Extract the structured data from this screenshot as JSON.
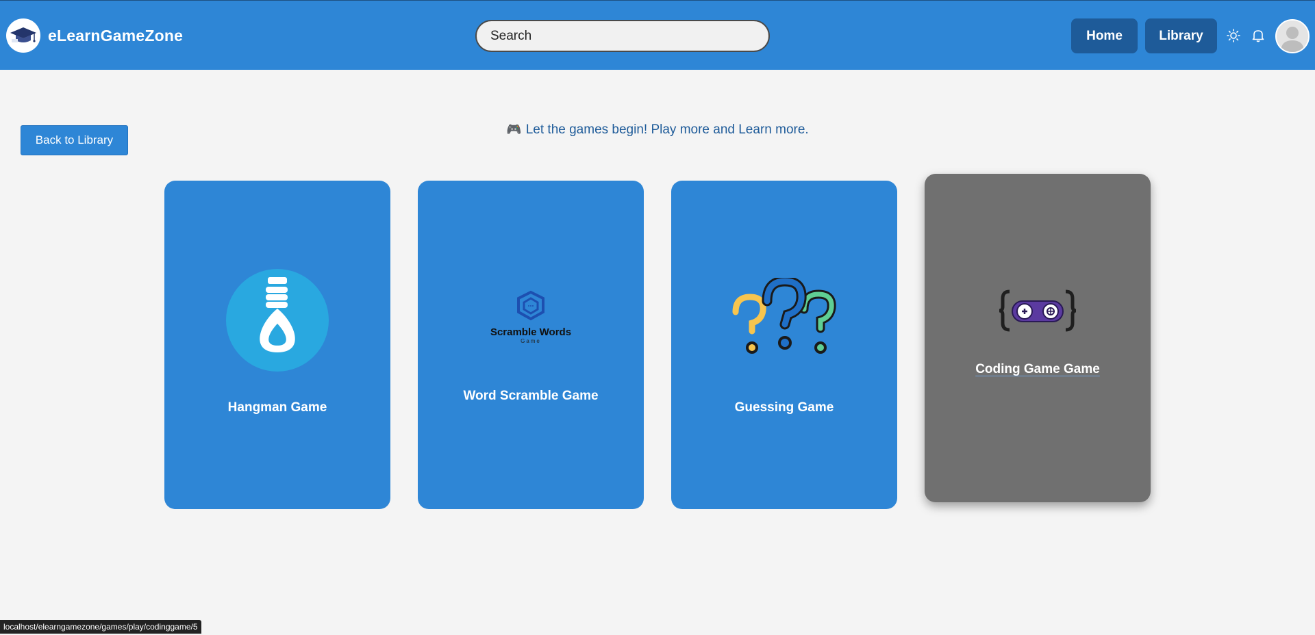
{
  "header": {
    "brand": "eLearnGameZone",
    "search_placeholder": "Search",
    "nav": {
      "home": "Home",
      "library": "Library"
    }
  },
  "main": {
    "back_label": "Back to Library",
    "tagline": "Let the games begin! Play more and Learn more.",
    "games": [
      {
        "title": "Hangman Game",
        "icon": "noose-icon"
      },
      {
        "title": "Word Scramble Game",
        "icon": "scramble-words-logo",
        "logo_title": "Scramble Words",
        "logo_sub": "Game"
      },
      {
        "title": "Guessing Game",
        "icon": "question-marks-icon"
      },
      {
        "title": "Coding Game Game",
        "icon": "gamepad-braces-icon"
      }
    ]
  },
  "status_bar": {
    "url": "localhost/elearngamezone/games/play/codinggame/5"
  },
  "colors": {
    "primary": "#2e86d6",
    "nav_button": "#1e5b99",
    "hover_card": "#707070",
    "background": "#f4f4f4"
  }
}
